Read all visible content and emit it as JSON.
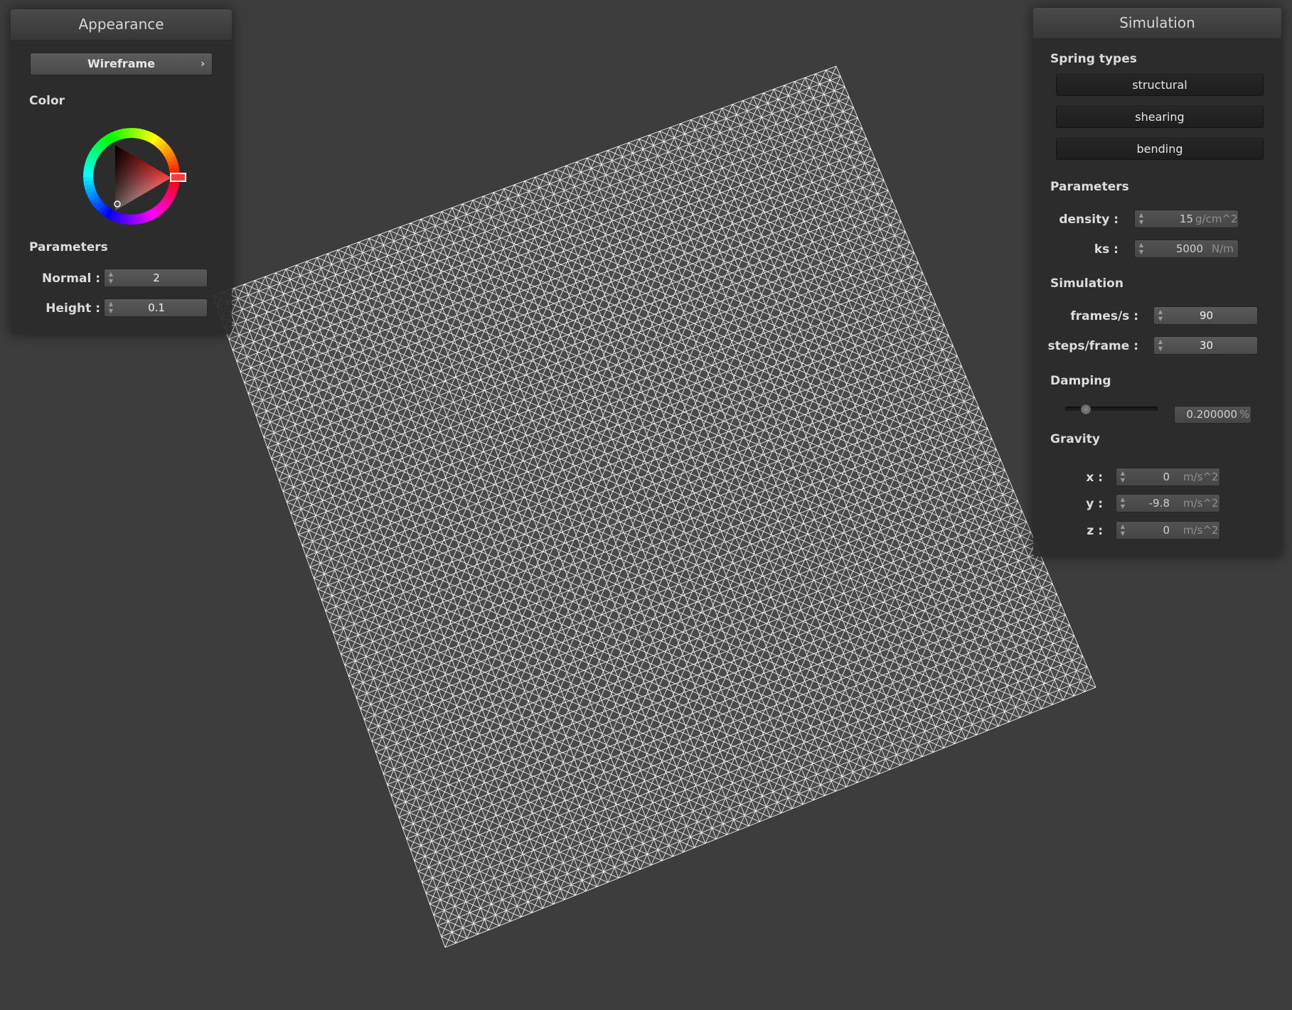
{
  "viewport": {
    "background": "#3d3d3d",
    "mesh_color": "#ffffff",
    "mesh_grid": 60
  },
  "appearance_panel": {
    "title": "Appearance",
    "shader_dropdown": {
      "value": "Wireframe",
      "icon": "chevron-right-icon"
    },
    "color_section_label": "Color",
    "color_picker": {
      "selected_hue": "#ff0000"
    },
    "parameters_section_label": "Parameters",
    "normal": {
      "label": "Normal :",
      "value": "2"
    },
    "height": {
      "label": "Height :",
      "value": "0.1"
    }
  },
  "simulation_panel": {
    "title": "Simulation",
    "spring_types": {
      "label": "Spring types",
      "buttons": [
        "structural",
        "shearing",
        "bending"
      ]
    },
    "parameters": {
      "label": "Parameters",
      "density": {
        "label": "density :",
        "value": "15",
        "unit": "g/cm^2"
      },
      "ks": {
        "label": "ks :",
        "value": "5000",
        "unit": "N/m"
      }
    },
    "simulation": {
      "label": "Simulation",
      "frames_per_s": {
        "label": "frames/s :",
        "value": "90"
      },
      "steps_per_frame": {
        "label": "steps/frame :",
        "value": "30"
      }
    },
    "damping": {
      "label": "Damping",
      "slider_fraction": 0.2,
      "value": "0.200000",
      "unit": "%"
    },
    "gravity": {
      "label": "Gravity",
      "x": {
        "label": "x :",
        "value": "0",
        "unit": "m/s^2"
      },
      "y": {
        "label": "y :",
        "value": "-9.8",
        "unit": "m/s^2"
      },
      "z": {
        "label": "z :",
        "value": "0",
        "unit": "m/s^2"
      }
    }
  }
}
